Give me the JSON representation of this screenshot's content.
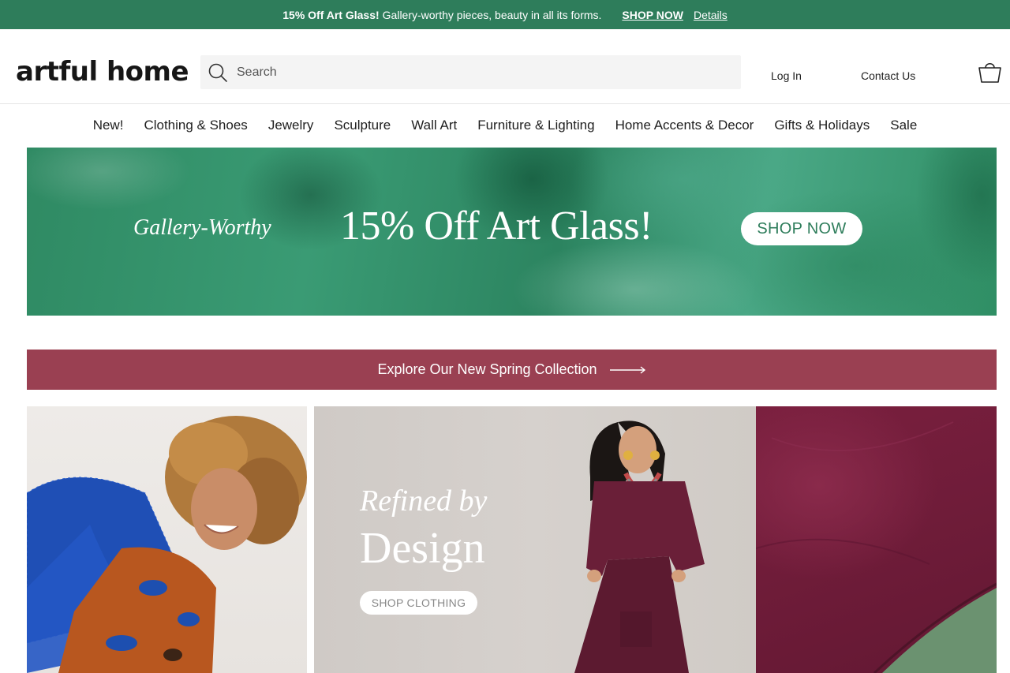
{
  "promo": {
    "bold": "15% Off Art Glass!",
    "message": "Gallery-worthy pieces, beauty in all its forms.",
    "shop_link": "SHOP NOW",
    "details_link": "Details"
  },
  "header": {
    "logo": "artful home",
    "search_placeholder": "Search",
    "login": "Log In",
    "contact": "Contact Us"
  },
  "nav": {
    "items": [
      "New!",
      "Clothing & Shoes",
      "Jewelry",
      "Sculpture",
      "Wall Art",
      "Furniture & Lighting",
      "Home Accents & Decor",
      "Gifts & Holidays",
      "Sale"
    ]
  },
  "hero": {
    "script": "Gallery-Worthy",
    "title": "15% Off Art Glass!",
    "button": "SHOP NOW"
  },
  "explore": {
    "label": "Explore Our New Spring Collection"
  },
  "feature": {
    "script": "Refined by",
    "title": "Design",
    "button": "SHOP CLOTHING"
  },
  "colors": {
    "brand_green": "#2e7d5b",
    "explore_burgundy": "#9a4052",
    "fabric_plum": "#6f1c39"
  }
}
